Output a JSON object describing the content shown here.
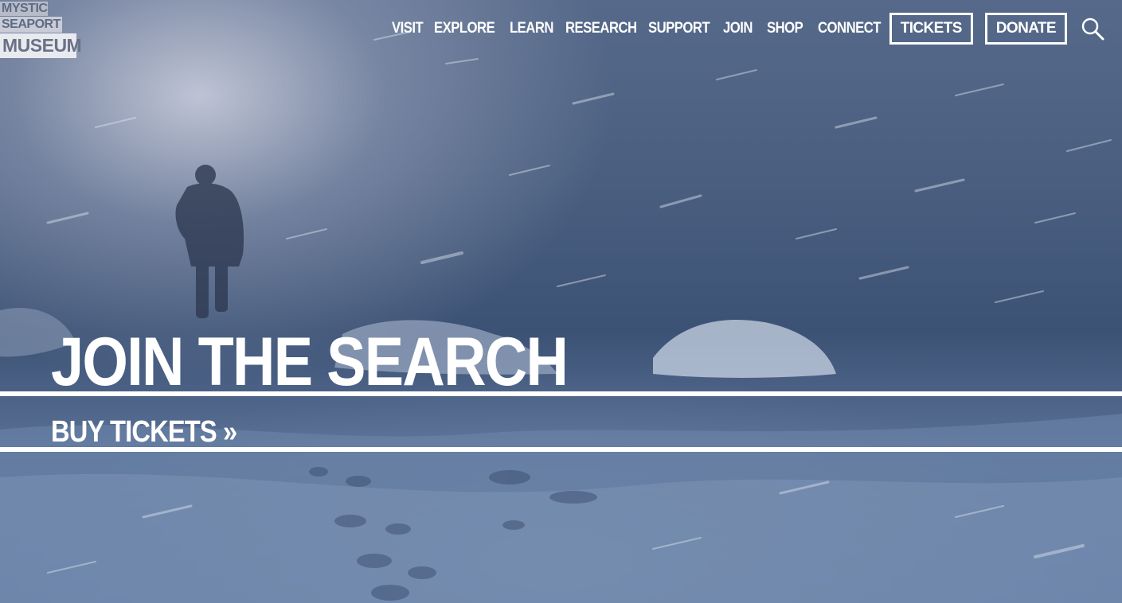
{
  "logo": {
    "line1": "MYSTIC",
    "line2": "SEAPORT",
    "line3": "MUSEUM"
  },
  "nav": {
    "items": [
      "VISIT",
      "EXPLORE",
      "LEARN",
      "RESEARCH",
      "SUPPORT",
      "JOIN",
      "SHOP",
      "CONNECT"
    ],
    "tickets_label": "TICKETS",
    "donate_label": "DONATE",
    "search_icon": "search-icon"
  },
  "hero": {
    "title": "JOIN THE SEARCH",
    "cta_label": "BUY TICKETS »"
  },
  "colors": {
    "text": "#ffffff",
    "background": "#4a5f80"
  }
}
